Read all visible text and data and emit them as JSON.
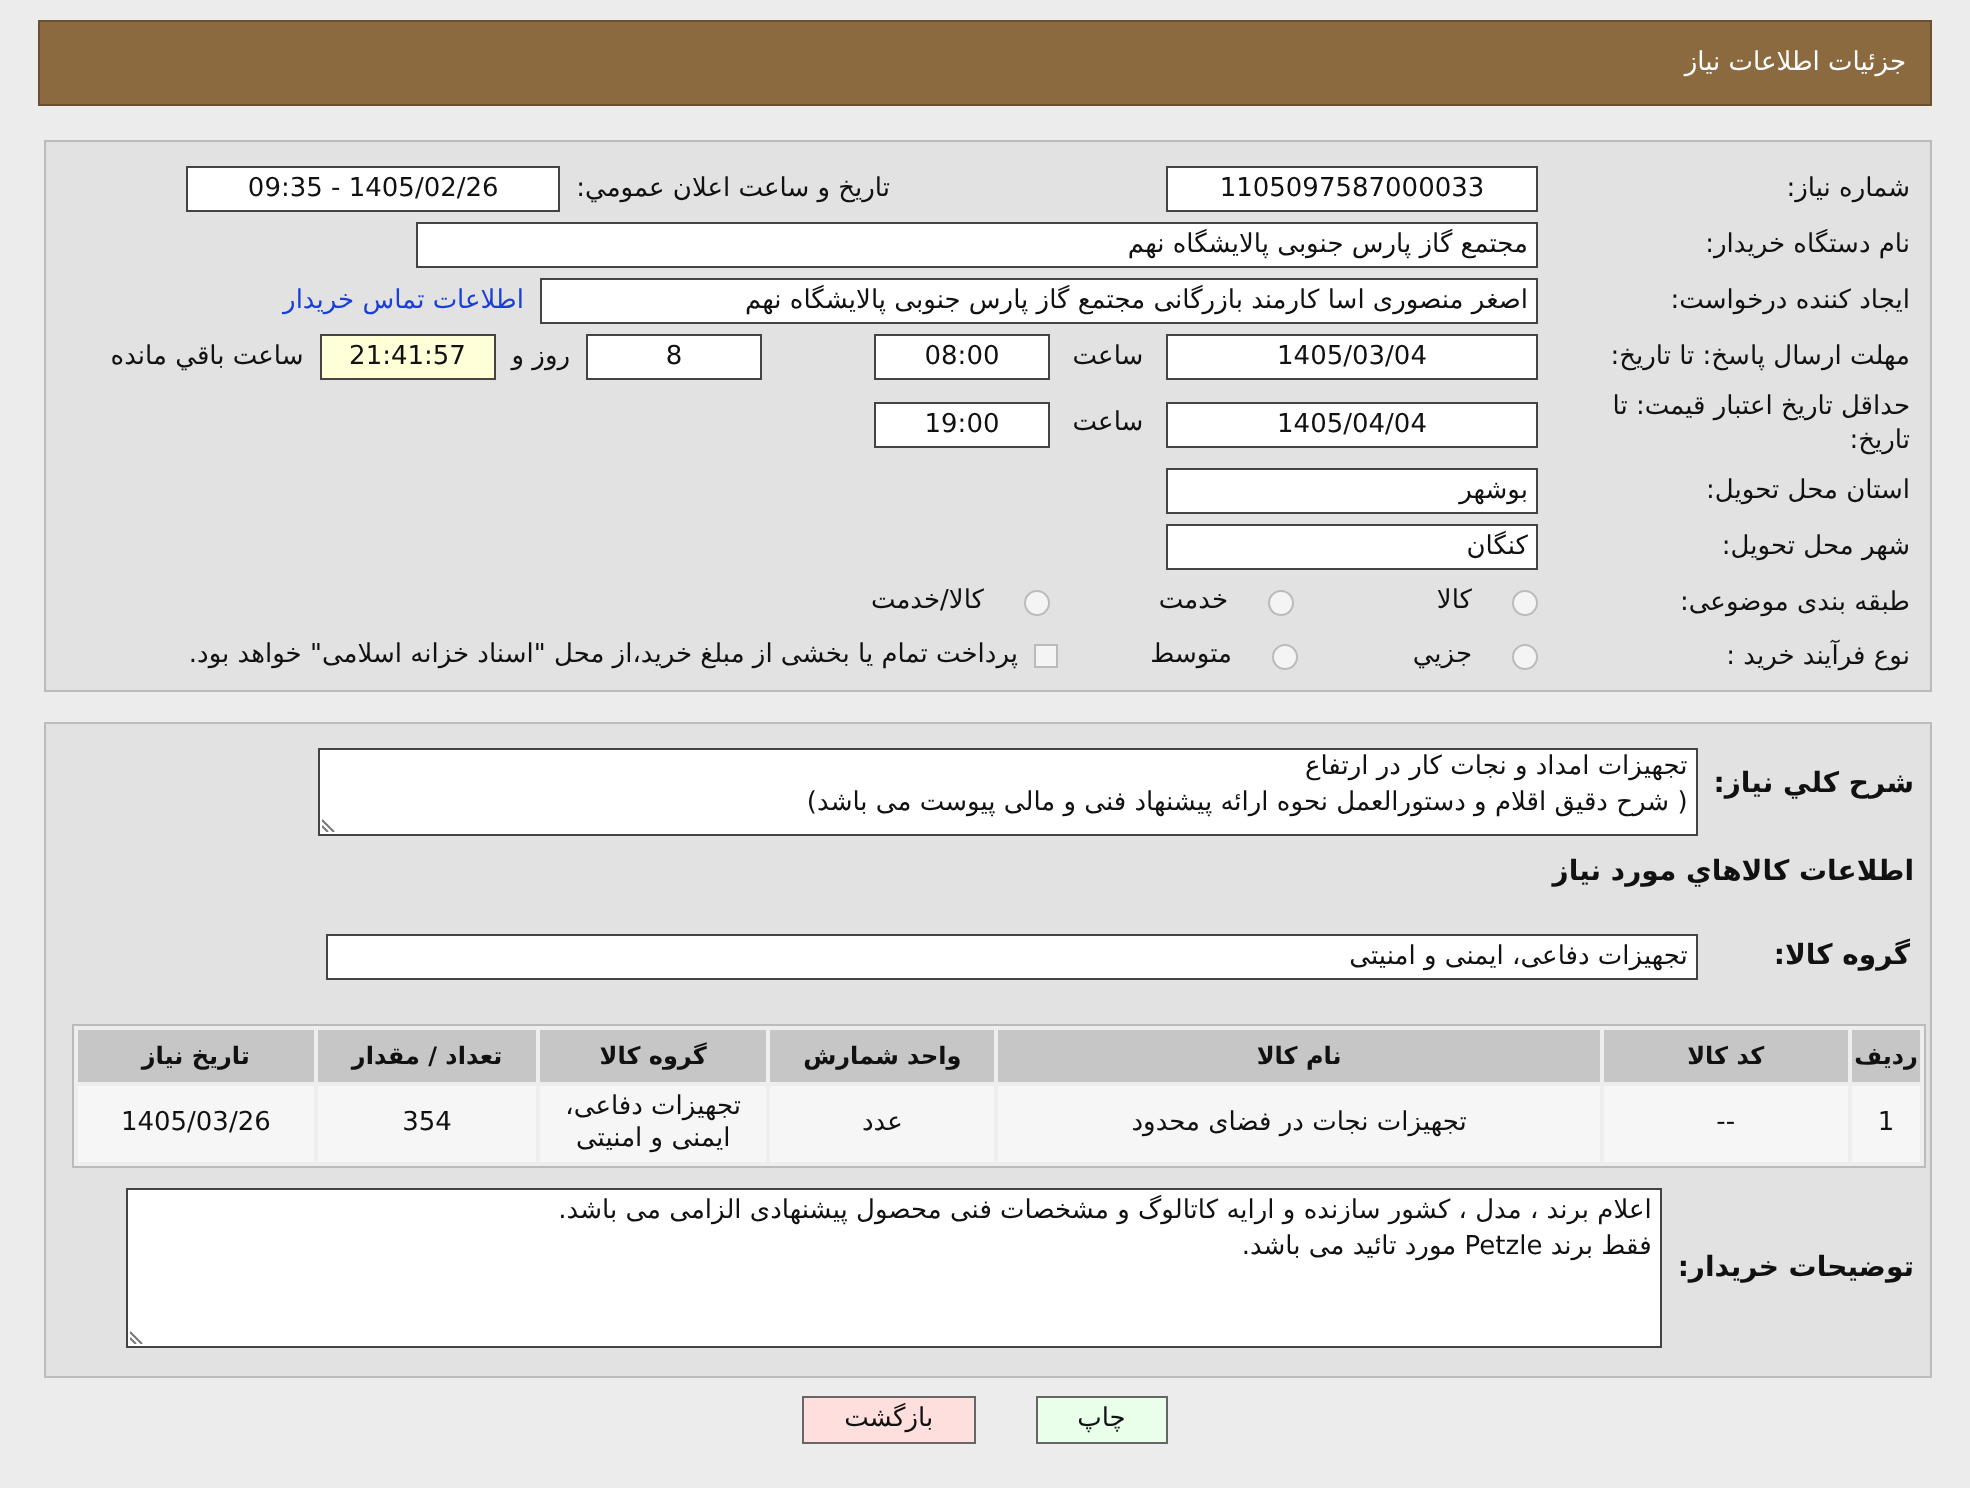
{
  "header": {
    "title": "جزئیات اطلاعات نیاز"
  },
  "need_number": {
    "label": "شماره نیاز:",
    "value": "1105097587000033"
  },
  "announce": {
    "label": "تاريخ و ساعت اعلان عمومي:",
    "value": "1405/02/26 - 09:35"
  },
  "buyer_org": {
    "label": "نام دستگاه خريدار:",
    "value": "مجتمع گاز پارس جنوبی  پالایشگاه نهم"
  },
  "creator": {
    "label": "ايجاد کننده درخواست:",
    "value": "اصغر منصوری اسا کارمند بازرگانی مجتمع گاز پارس جنوبی  پالایشگاه نهم",
    "link": "اطلاعات تماس خريدار"
  },
  "reply_deadline": {
    "label": "مهلت ارسال پاسخ: تا تاريخ:",
    "date": "1405/03/04",
    "time_label": "ساعت",
    "time": "08:00",
    "days": "8",
    "days_label": "روز و",
    "remaining": "21:41:57",
    "remaining_label": "ساعت باقي مانده"
  },
  "validity": {
    "label": "حداقل تاريخ اعتبار قيمت: تا تاريخ:",
    "date": "1405/04/04",
    "time_label": "ساعت",
    "time": "19:00"
  },
  "province": {
    "label": "استان محل تحويل:",
    "value": "بوشهر"
  },
  "city": {
    "label": "شهر محل تحويل:",
    "value": "کنگان"
  },
  "category": {
    "label": "طبقه بندی موضوعی:",
    "options": [
      {
        "label": "کالا",
        "selected": false
      },
      {
        "label": "خدمت",
        "selected": false
      },
      {
        "label": "کالا/خدمت",
        "selected": false
      }
    ]
  },
  "process": {
    "label": "نوع فرآيند خريد :",
    "options": [
      {
        "label": "جزيي",
        "selected": false
      },
      {
        "label": "متوسط",
        "selected": false
      }
    ],
    "payment": {
      "label": "پرداخت تمام يا بخشی از مبلغ خريد،از محل \"اسناد خزانه اسلامی\" خواهد بود.",
      "checked": false
    }
  },
  "description": {
    "label": "شرح کلي نياز:",
    "lines": [
      "تجهیزات امداد و نجات کار در ارتفاع",
      "( شرح دقیق اقلام و دستورالعمل نحوه ارائه پیشنهاد فنی و مالی پیوست می باشد)"
    ]
  },
  "goods_title": "اطلاعات کالاهاي مورد نياز",
  "group": {
    "label": "گروه کالا:",
    "value": "تجهیزات دفاعی، ایمنی و امنیتی"
  },
  "table": {
    "columns": [
      "رديف",
      "کد کالا",
      "نام کالا",
      "واحد شمارش",
      "گروه کالا",
      "تعداد / مقدار",
      "تاريخ نياز"
    ],
    "rows": [
      [
        "1",
        "--",
        "تجهیزات نجات در فضای محدود",
        "عدد",
        "تجهیزات دفاعی، ایمنی و امنیتی",
        "354",
        "1405/03/26"
      ]
    ]
  },
  "buyer_notes": {
    "label": "توضيحات خريدار:",
    "lines": [
      "اعلام برند ، مدل ، کشور سازنده و ارایه کاتالوگ و مشخصات فنی محصول پیشنهادی الزامی می باشد.",
      "فقط برند Petzle مورد تائید می باشد."
    ]
  },
  "buttons": [
    {
      "kind": "print",
      "label": "چاپ"
    },
    {
      "kind": "back",
      "label": "بازگشت"
    }
  ]
}
